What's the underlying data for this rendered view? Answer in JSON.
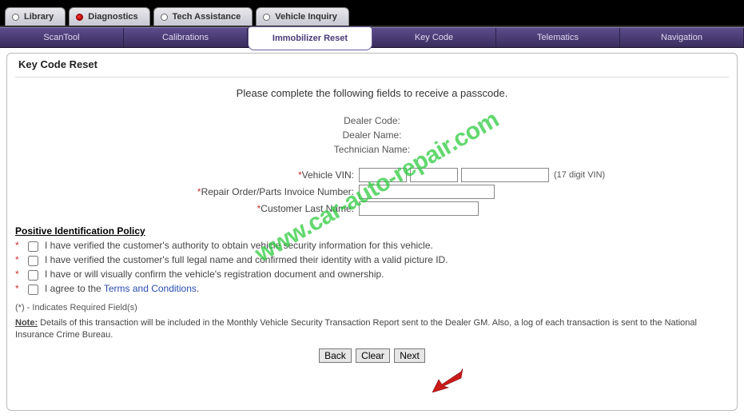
{
  "top_tabs": {
    "library": "Library",
    "diagnostics": "Diagnostics",
    "tech_assistance": "Tech Assistance",
    "vehicle_inquiry": "Vehicle Inquiry"
  },
  "sub_tabs": {
    "scantool": "ScanTool",
    "calibrations": "Calibrations",
    "immobilizer_reset": "Immobilizer Reset",
    "key_code": "Key Code",
    "telematics": "Telematics",
    "navigation": "Navigation"
  },
  "panel": {
    "title": "Key Code Reset",
    "instruction": "Please complete the following fields to receive a passcode.",
    "info": {
      "dealer_code": "Dealer Code:",
      "dealer_name": "Dealer Name:",
      "technician_name": "Technician Name:"
    },
    "form": {
      "vehicle_vin_label": "Vehicle VIN:",
      "vehicle_vin_hint": "(17 digit VIN)",
      "repair_order_label": "Repair Order/Parts Invoice Number:",
      "customer_last_name_label": "Customer Last Name:"
    },
    "policy": {
      "heading": "Positive Identification Policy",
      "item1": "I have verified the customer's authority to obtain vehicle security information for this vehicle.",
      "item2": "I have verified the customer's full legal name and confirmed their identity with a valid picture ID.",
      "item3": "I have or will visually confirm the vehicle's registration document and ownership.",
      "item4_prefix": "I agree to the ",
      "item4_link": "Terms and Conditions",
      "item4_suffix": "."
    },
    "required_footnote": "(*) - Indicates Required Field(s)",
    "note_label": "Note:",
    "note_text": "Details of this transaction will be included in the Monthly Vehicle Security Transaction Report sent to the Dealer GM. Also, a log of each transaction is sent to the National Insurance Crime Bureau.",
    "buttons": {
      "back": "Back",
      "clear": "Clear",
      "next": "Next"
    }
  },
  "watermark": "www.car-auto-repair.com"
}
